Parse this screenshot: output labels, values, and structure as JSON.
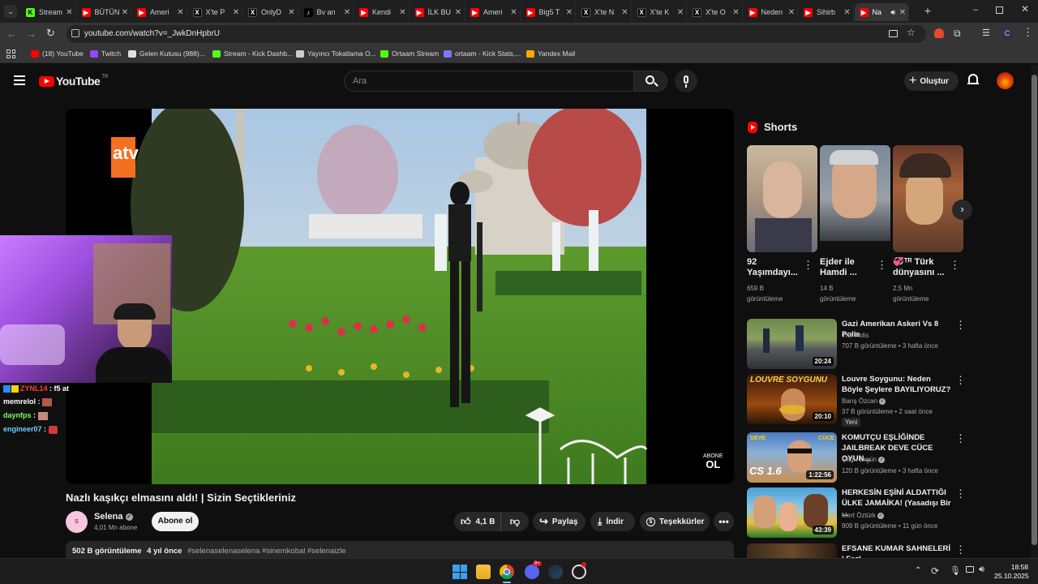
{
  "tabs": [
    {
      "title": "Stream",
      "icon": "kick"
    },
    {
      "title": "BÜTÜN",
      "icon": "youtube"
    },
    {
      "title": "Ameri",
      "icon": "youtube"
    },
    {
      "title": "X'te P",
      "icon": "x"
    },
    {
      "title": "OnlyD",
      "icon": "x"
    },
    {
      "title": "Bv an",
      "icon": "tiktok"
    },
    {
      "title": "Kendi",
      "icon": "youtube"
    },
    {
      "title": "İLK BU",
      "icon": "youtube"
    },
    {
      "title": "Ameri",
      "icon": "youtube"
    },
    {
      "title": "Big5 T",
      "icon": "youtube"
    },
    {
      "title": "X'te N",
      "icon": "x"
    },
    {
      "title": "X'te K",
      "icon": "x"
    },
    {
      "title": "X'te O",
      "icon": "x"
    },
    {
      "title": "Neden",
      "icon": "youtube"
    },
    {
      "title": "Sihirb",
      "icon": "youtube"
    },
    {
      "title": "Na",
      "icon": "youtube"
    }
  ],
  "address_bar": {
    "url": "youtube.com/watch?v=_JwkDnHpbrU"
  },
  "bookmarks": [
    {
      "label": "(18) YouTube",
      "color": "#ff0000"
    },
    {
      "label": "Twitch",
      "color": "#9146ff"
    },
    {
      "label": "Gelen Kutusu (988)...",
      "color": "#e0e0e0"
    },
    {
      "label": "Stream - Kick Dashb...",
      "color": "#53fc18"
    },
    {
      "label": "Yayıncı Tokatlama O...",
      "color": "#cccccc"
    },
    {
      "label": "Ortaam Stream",
      "color": "#53fc18"
    },
    {
      "label": "ortaam - Kick Stats,...",
      "color": "#7a7aff"
    },
    {
      "label": "Yandex Mail",
      "color": "#ffaa00"
    }
  ],
  "header": {
    "logo_text": "YouTube",
    "region": "TR",
    "search_placeholder": "Ara",
    "create_label": "Oluştur"
  },
  "video": {
    "channel_bug": "atv",
    "watermark_line1": "ABONE",
    "watermark_line2": "OL",
    "title": "Nazlı kaşıkçı elmasını aldı! | Sizin Seçtikleriniz",
    "channel": "Selena",
    "subscribers": "4,01 Mn abone",
    "subscribe_label": "Abone ol",
    "likes": "4,1 B",
    "share_label": "Paylaş",
    "download_label": "İndir",
    "thanks_label": "Teşekkürler",
    "views": "502 B görüntüleme",
    "age": "4 yıl önce",
    "hashtags": "#selenaselenaselena #sinemkobal #selenaizle"
  },
  "chat": [
    {
      "user": "ZYNL14",
      "msg": ": f5 at",
      "color": "#ff3b3b"
    },
    {
      "user": "memrelol",
      "msg": ":",
      "color": "#ffffff"
    },
    {
      "user": "daynfps",
      "msg": ":",
      "color": "#7cff5b"
    },
    {
      "user": "engineer07",
      "msg": ":",
      "color": "#6ad1ff"
    }
  ],
  "shorts": {
    "heading": "Shorts",
    "items": [
      {
        "title_line1": "92",
        "title_line2": "Yaşımdayı...",
        "views": "659 B",
        "views_label": "görüntüleme"
      },
      {
        "title_line1": "Ejder ile",
        "title_line2": "Hamdi ...",
        "views": "14 B",
        "views_label": "görüntüleme"
      },
      {
        "title_line1": "💞ᵀᴿ Türk",
        "title_line2": "dünyasını ...",
        "views": "2,5 Mn",
        "views_label": "görüntüleme"
      }
    ]
  },
  "recommended": [
    {
      "title": "Gazi Amerikan Askeri Vs 8 Polis",
      "channel": "The Polis",
      "verified": false,
      "meta": "707 B görüntüleme • 3 hafta önce",
      "duration": "20:24",
      "badge": ""
    },
    {
      "title": "Louvre Soygunu: Neden Böyle Şeylere BAYILIYORUZ?",
      "channel": "Barış Özcan",
      "verified": true,
      "meta": "37 B görüntüleme • 2 saat önce",
      "duration": "20:10",
      "badge": "Yeni"
    },
    {
      "title": "KOMUTÇU EŞLİĞİNDE JAILBREAK DEVE CÜCE OYUN...",
      "channel": "Çağrı Ergün",
      "verified": true,
      "meta": "120 B görüntüleme • 3 hafta önce",
      "duration": "1:22:56",
      "badge": ""
    },
    {
      "title": "HERKESİN EŞİNİ ALDATTIĞI ÜLKE JAMAİKA! (Yasadışı Bir ...",
      "channel": "Mert Öztürk",
      "verified": true,
      "meta": "909 B görüntüleme • 11 gün önce",
      "duration": "43:39",
      "badge": ""
    },
    {
      "title": "EFSANE KUMAR SAHNELERİ | Fazl...",
      "channel": "",
      "verified": false,
      "meta": "",
      "duration": "",
      "badge": ""
    }
  ],
  "thumb_text": {
    "louvre": "LOUVRE SOYGUNU",
    "cs": "CS 1.6",
    "deve": "DEVE",
    "cuce": "CÜCE"
  },
  "taskbar": {
    "time": "18:58",
    "date": "25.10.2025",
    "discord_badge": "9+"
  },
  "colors": {
    "youtube_red": "#ff0000",
    "kick_green": "#53fc18",
    "background": "#0f0f0f"
  }
}
